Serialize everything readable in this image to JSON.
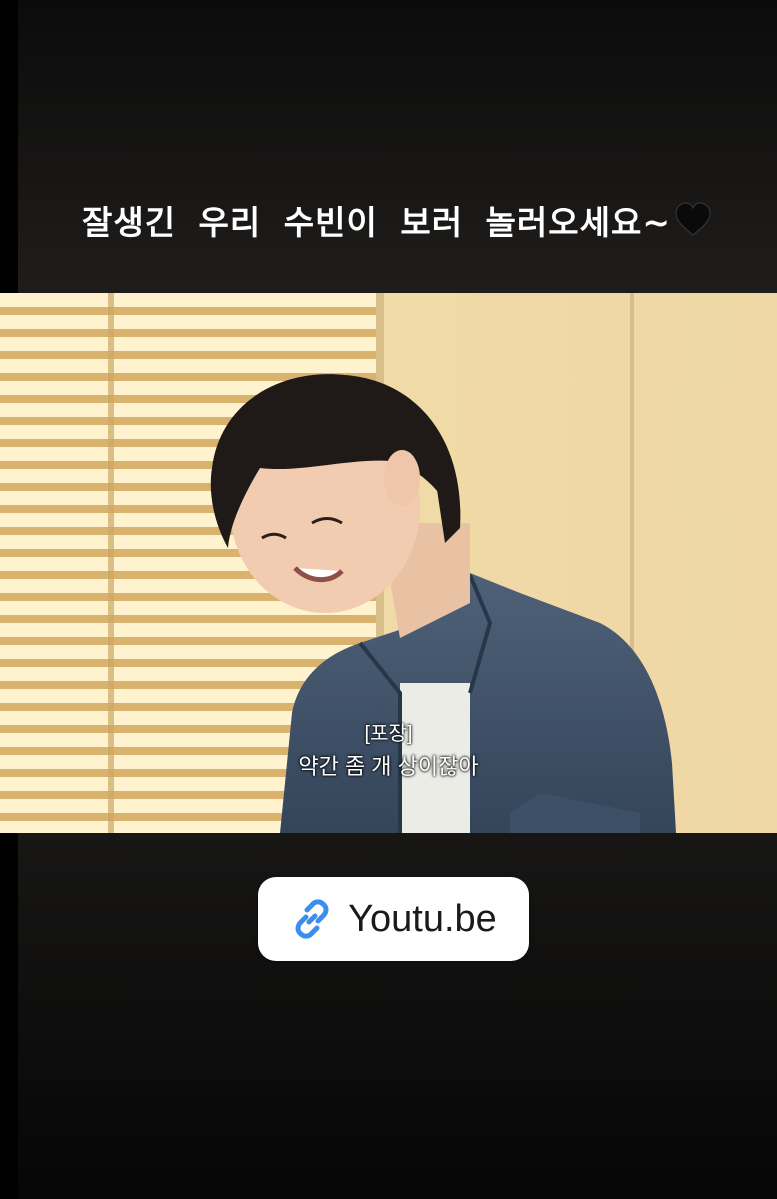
{
  "story": {
    "caption": "잘생긴 우리 수빈이 보러 놀러오세요~",
    "caption_emoji": "black-heart-icon"
  },
  "video": {
    "subtitle_tag": "[포장]",
    "subtitle_line": "약간 좀 개 상이잖아"
  },
  "link_sticker": {
    "icon": "link-icon",
    "label": "Youtu.be",
    "icon_color": "#3b8ef0"
  },
  "colors": {
    "background": "#1c1b19",
    "caption_text": "#ffffff"
  }
}
